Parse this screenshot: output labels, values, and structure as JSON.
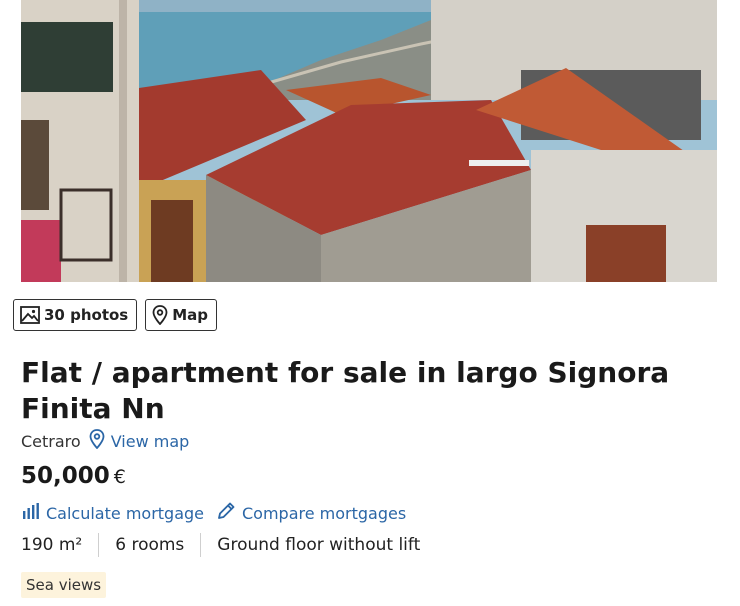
{
  "gallery": {
    "photos_label": "30 photos",
    "map_label": "Map"
  },
  "listing": {
    "title": "Flat / apartment for sale in largo Signora Finita Nn",
    "location": "Cetraro",
    "view_map_label": "View map",
    "price_amount": "50,000",
    "price_currency": "€"
  },
  "mortgage": {
    "calculate_label": "Calculate mortgage",
    "compare_label": "Compare mortgages"
  },
  "features": [
    "190 m²",
    "6 rooms",
    "Ground floor without lift"
  ],
  "tags": [
    "Sea views"
  ],
  "colors": {
    "link": "#2b66a6",
    "tag_bg": "#fdf3dc",
    "roof": "#a33a2e"
  }
}
